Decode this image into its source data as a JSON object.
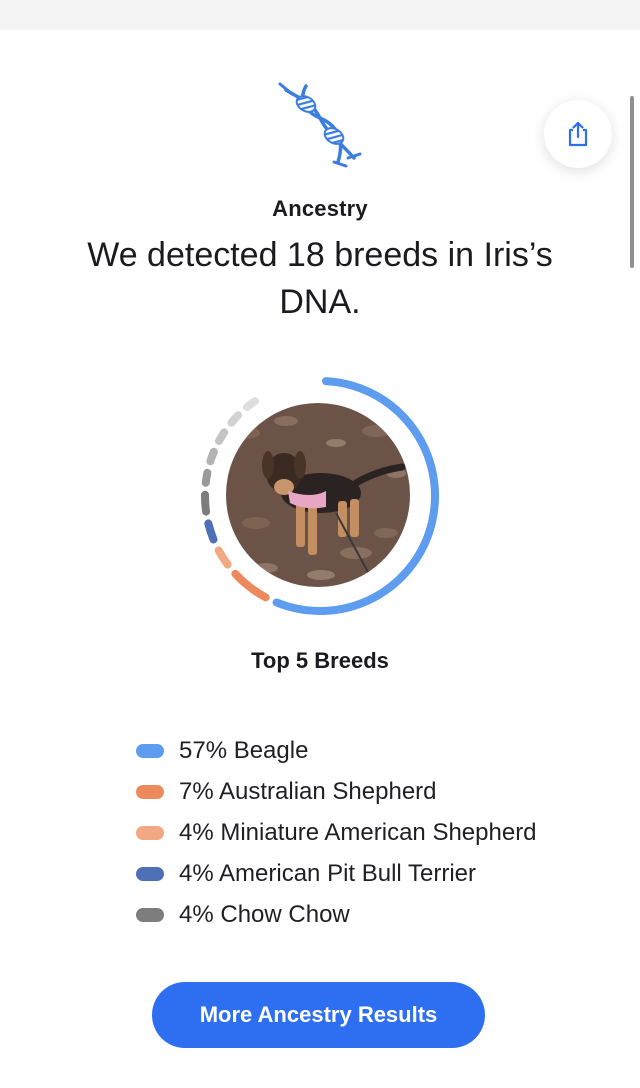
{
  "header": {
    "section_label": "Ancestry",
    "headline": "We detected 18 breeds in Iris’s DNA.",
    "share_icon": "share-icon",
    "dna_icon": "dna-icon"
  },
  "photo": {
    "alt": "Iris"
  },
  "chart_data": {
    "type": "donut",
    "total_breeds_detected": 18,
    "series": [
      {
        "name": "Beagle",
        "value": 57,
        "color": "#5e9cf0"
      },
      {
        "name": "Australian Shepherd",
        "value": 7,
        "color": "#ec8a5e"
      },
      {
        "name": "Miniature American Shepherd",
        "value": 4,
        "color": "#f0a983"
      },
      {
        "name": "American Pit Bull Terrier",
        "value": 4,
        "color": "#4f6fb7"
      },
      {
        "name": "Chow Chow",
        "value": 4,
        "color": "#7d7d7d"
      }
    ]
  },
  "top_breeds": {
    "title": "Top 5 Breeds",
    "items": [
      {
        "label": "57% Beagle",
        "color": "#5e9cf0"
      },
      {
        "label": "7% Australian Shepherd",
        "color": "#ec8a5e"
      },
      {
        "label": "4% Miniature American Shepherd",
        "color": "#f0a983"
      },
      {
        "label": "4% American Pit Bull Terrier",
        "color": "#4f6fb7"
      },
      {
        "label": "4% Chow Chow",
        "color": "#7d7d7d"
      }
    ]
  },
  "actions": {
    "more_results_label": "More Ancestry Results"
  },
  "colors": {
    "accent": "#2e6ff2",
    "dna_blue": "#3c7de0"
  }
}
